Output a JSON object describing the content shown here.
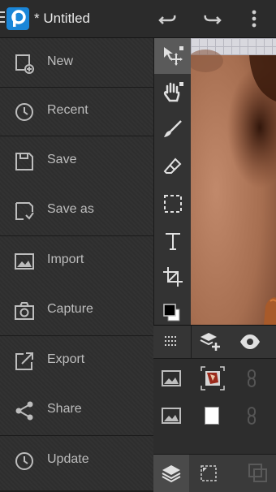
{
  "app": {
    "title": "* Untitled"
  },
  "menu": {
    "items": [
      {
        "label": "New",
        "icon": "new-file-icon"
      },
      {
        "label": "Recent",
        "icon": "clock-icon"
      },
      {
        "label": "Save",
        "icon": "save-icon"
      },
      {
        "label": "Save as",
        "icon": "save-as-icon"
      },
      {
        "label": "Import",
        "icon": "image-icon"
      },
      {
        "label": "Capture",
        "icon": "camera-icon"
      },
      {
        "label": "Export",
        "icon": "export-icon"
      },
      {
        "label": "Share",
        "icon": "share-icon"
      },
      {
        "label": "Update",
        "icon": "clock-icon"
      }
    ]
  },
  "tools": [
    "move-tool",
    "pan-tool",
    "brush-tool",
    "eraser-tool",
    "selection-tool",
    "text-tool",
    "crop-tool",
    "color-swatch"
  ],
  "colors": {
    "brand": "#1a86d8",
    "panel": "#2f2f2f",
    "active_tool": "#5a5a5a"
  }
}
